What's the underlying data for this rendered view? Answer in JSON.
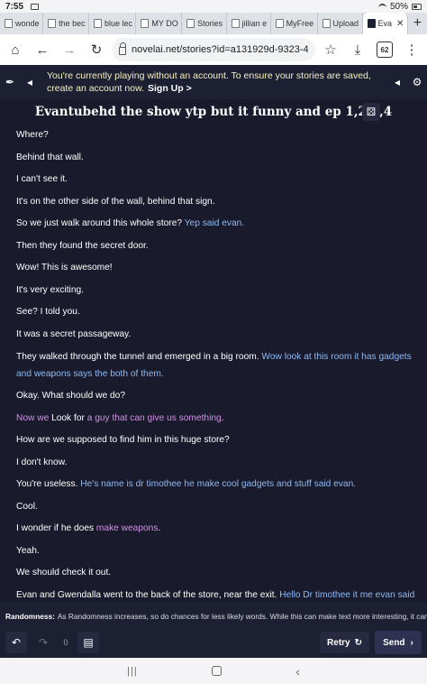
{
  "status": {
    "time": "7:55",
    "battery": "50%"
  },
  "tabs": [
    {
      "label": "wonde"
    },
    {
      "label": "the bec"
    },
    {
      "label": "blue lec"
    },
    {
      "label": "MY DO"
    },
    {
      "label": "Stories"
    },
    {
      "label": "jillian e"
    },
    {
      "label": "MyFree"
    },
    {
      "label": "Upload"
    },
    {
      "label": "Eva"
    }
  ],
  "toolbar": {
    "url": "novelai.net/stories?id=a131929d-9323-44fa-9ce6-(",
    "tab_count": "62"
  },
  "banner": {
    "text": "You're currently playing without an account. To ensure your stories are saved, create an account now.",
    "signup": "Sign Up >"
  },
  "story": {
    "title": "Evantubehd the show ytp but it funny and ep 1,2,3,4",
    "lines": [
      {
        "segments": [
          {
            "t": "Where?",
            "k": "ai"
          }
        ]
      },
      {
        "segments": [
          {
            "t": "Behind that wall.",
            "k": "ai"
          }
        ]
      },
      {
        "segments": [
          {
            "t": "I can't see it.",
            "k": "ai"
          }
        ]
      },
      {
        "segments": [
          {
            "t": "It's on the other side of the wall, behind that sign.",
            "k": "ai"
          }
        ]
      },
      {
        "segments": [
          {
            "t": "So we just walk around this whole store? ",
            "k": "ai"
          },
          {
            "t": "Yep said evan.",
            "k": "user"
          }
        ]
      },
      {
        "segments": [
          {
            "t": "Then they found the secret door.",
            "k": "ai"
          }
        ]
      },
      {
        "segments": [
          {
            "t": "Wow! This is awesome!",
            "k": "ai"
          }
        ]
      },
      {
        "segments": [
          {
            "t": "It's very exciting.",
            "k": "ai"
          }
        ]
      },
      {
        "segments": [
          {
            "t": "See? I told you.",
            "k": "ai"
          }
        ]
      },
      {
        "segments": [
          {
            "t": "It was a secret passageway.",
            "k": "ai"
          }
        ]
      },
      {
        "wrap": true,
        "segments": [
          {
            "t": "They walked through the tunnel and emerged in a big room. ",
            "k": "ai"
          },
          {
            "t": "Wow look at this room it has gadgets and weapons",
            "k": "user"
          },
          {
            "t": " says the both of them.",
            "k": "user"
          }
        ]
      },
      {
        "segments": [
          {
            "t": "Okay. What should we do?",
            "k": "ai"
          }
        ]
      },
      {
        "segments": [
          {
            "t": "Now we",
            "k": "edit"
          },
          {
            "t": " Look for ",
            "k": "ai"
          },
          {
            "t": "a guy that can give us something",
            "k": "edit"
          },
          {
            "t": ".",
            "k": "ai"
          }
        ]
      },
      {
        "segments": [
          {
            "t": "How are we supposed to find him in this huge store?",
            "k": "ai"
          }
        ]
      },
      {
        "segments": [
          {
            "t": "I don't know.",
            "k": "ai"
          }
        ]
      },
      {
        "segments": [
          {
            "t": "You're useless. ",
            "k": "ai"
          },
          {
            "t": " He's name is dr timothee he make cool gadgets and stuff said evan.",
            "k": "user"
          }
        ]
      },
      {
        "segments": [
          {
            "t": "Cool.",
            "k": "ai"
          }
        ]
      },
      {
        "segments": [
          {
            "t": "I wonder if he does ",
            "k": "ai"
          },
          {
            "t": "make weapons",
            "k": "edit"
          },
          {
            "t": ".",
            "k": "ai"
          }
        ]
      },
      {
        "segments": [
          {
            "t": "Yeah.",
            "k": "ai"
          }
        ]
      },
      {
        "segments": [
          {
            "t": "We should check it out.",
            "k": "ai"
          }
        ]
      },
      {
        "segments": [
          {
            "t": "Evan and Gwendalla went to the back of the store, near the exit. ",
            "k": "ai"
          },
          {
            "t": "Hello Dr timothee it me evan said",
            "k": "user"
          }
        ]
      }
    ]
  },
  "tip": {
    "label": "Randomness:",
    "text": "As Randomness increases, so do chances for less likely words. While this can make text more interesting, it can..."
  },
  "controls": {
    "undo_count": "0",
    "retry_label": "Retry",
    "send_label": "Send"
  },
  "colors": {
    "ai": "#ffffff",
    "user": "#8fb8f0",
    "edit": "#d28fe6",
    "background": "#191b2c"
  }
}
